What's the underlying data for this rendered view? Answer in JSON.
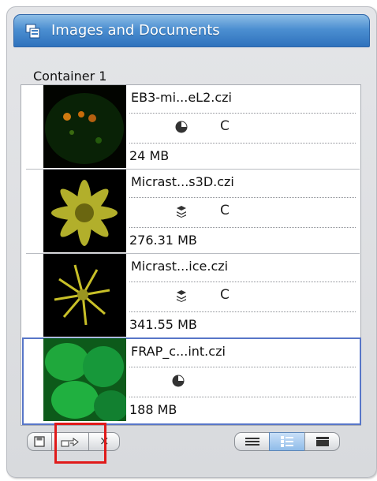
{
  "panel": {
    "title": "Images and Documents",
    "container_label": "Container 1"
  },
  "documents": [
    {
      "name": "EB3-mi...eL2.czi",
      "icon": "clock-icon",
      "channel": "C",
      "size": "24 MB",
      "selected": false
    },
    {
      "name": "Micrast...s3D.czi",
      "icon": "z-stack-icon",
      "channel": "C",
      "size": "276.31 MB",
      "selected": false
    },
    {
      "name": "Micrast...ice.czi",
      "icon": "z-stack-icon",
      "channel": "C",
      "size": "341.55 MB",
      "selected": false
    },
    {
      "name": "FRAP_c...int.czi",
      "icon": "clock-icon",
      "channel": "",
      "size": "188 MB",
      "selected": true
    }
  ],
  "toolbar": {
    "left_buttons": [
      "save-icon",
      "export-icon",
      "close-icon"
    ],
    "view_buttons": [
      "list-view-icon",
      "detail-view-icon",
      "gallery-view-icon"
    ],
    "active_view": "detail-view-icon",
    "close_glyph": "×"
  },
  "colors": {
    "title_bar": "#4c8fd1",
    "selection_border": "#5876c8",
    "highlight": "#e01a1a"
  }
}
